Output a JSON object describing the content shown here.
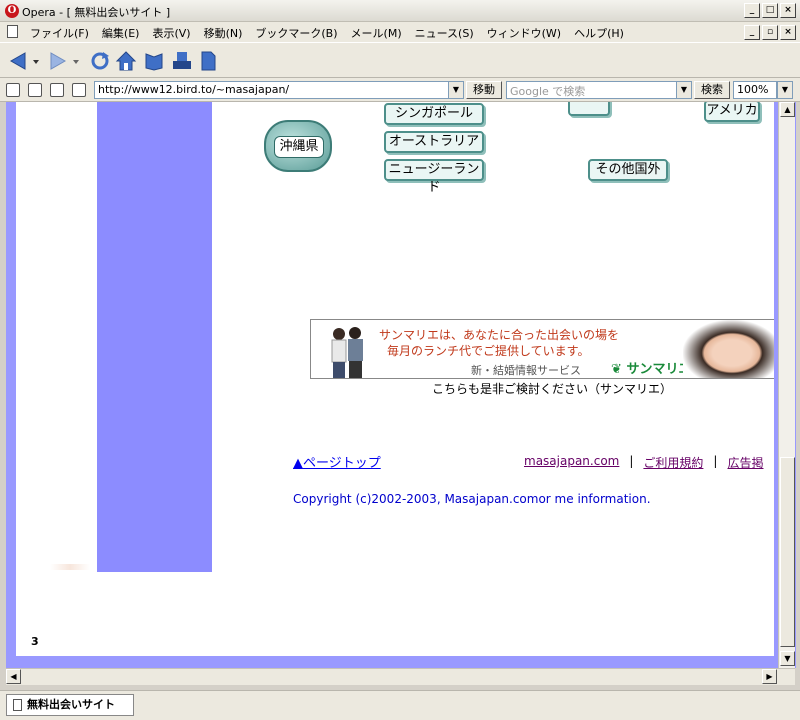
{
  "window": {
    "title": "Opera - [ 無料出会いサイト ]",
    "app_icon_letter": "O",
    "controls": [
      "_",
      "□",
      "×"
    ],
    "doc_controls": [
      "_",
      "▫",
      "×"
    ]
  },
  "menu": {
    "items": [
      "ファイル(F)",
      "編集(E)",
      "表示(V)",
      "移動(N)",
      "ブックマーク(B)",
      "メール(M)",
      "ニュース(S)",
      "ウィンドウ(W)",
      "ヘルプ(H)"
    ]
  },
  "toolbar": {
    "icons": [
      "back-icon",
      "forward-icon",
      "reload-icon",
      "home-icon",
      "hotlist-icon",
      "print-icon",
      "new-page-icon"
    ]
  },
  "address": {
    "url": "http://www12.bird.to/~masajapan/",
    "go_label": "移動",
    "search_placeholder": "Google で検索",
    "search_label": "検索",
    "zoom": "100%"
  },
  "page": {
    "region_buttons": [
      "シンガポール",
      "オーストラリア",
      "ニュージーランド",
      "その他国外",
      "アメリカ"
    ],
    "okinawa": "沖縄県",
    "banner": {
      "line1": "サンマリエは、あなたに合った出会いの場を",
      "line2": "毎月のランチ代でご提供しています。",
      "service": "新・結婚情報サービス",
      "brand": "サンマリエ",
      "caption": "こちらも是非ご検討ください（サンマリエ）"
    },
    "page_top": "▲ページトップ",
    "footer_links": [
      "masajapan.com",
      "ご利用規約",
      "広告掲"
    ],
    "copyright": "Copyright (c)2002-2003, Masajapan.comor me information.",
    "page_number": "3"
  },
  "status": {
    "tab_title": "無料出会いサイト"
  },
  "colors": {
    "side_column": "#8c8cff",
    "frame": "#9999ff",
    "link": "#0000ee",
    "visited": "#660066",
    "banner_text": "#c0391b",
    "brand_green": "#1a8a3a"
  }
}
